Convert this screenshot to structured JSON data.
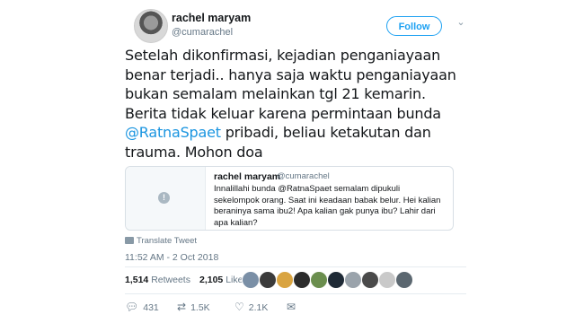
{
  "user": {
    "name": "rachel maryam",
    "handle": "@cumarachel"
  },
  "follow_label": "Follow",
  "tweet": {
    "text_before": "Setelah dikonfirmasi, kejadian penganiayaan benar terjadi.. hanya saja waktu penganiayaan bukan semalam melainkan tgl 21 kemarin. Berita tidak keluar karena permintaan bunda ",
    "mention": "@RatnaSpaet",
    "text_after": " pribadi, beliau ketakutan dan trauma. Mohon doa"
  },
  "quoted": {
    "name": "rachel maryam",
    "handle": "@cumarachel",
    "text": "Innalillahi bunda @RatnaSpaet semalam dipukuli sekelompok orang. Saat ini keadaan babak belur. Hei kalian beraninya sama ibu2! Apa kalian gak punya ibu? Lahir dari apa kalian?"
  },
  "translate_label": "Translate Tweet",
  "timestamp": "11:52 AM - 2 Oct 2018",
  "stats": {
    "retweets_count": "1,514",
    "retweets_label": "Retweets",
    "likes_count": "2,105",
    "likes_label": "Likes"
  },
  "likers_colors": [
    "#7a8fa6",
    "#3b3b3b",
    "#d9a441",
    "#2c2c2c",
    "#6b8e4e",
    "#1f2a36",
    "#9aa3ab",
    "#4a4a4a",
    "#c9c9c9",
    "#5b6770"
  ],
  "actions": {
    "reply_icon": "reply-icon",
    "reply_count": "431",
    "retweet_icon": "retweet-icon",
    "retweet_count": "1.5K",
    "like_icon": "heart-icon",
    "like_count": "2.1K",
    "dm_icon": "envelope-icon"
  },
  "colors": {
    "accent": "#1da1f2",
    "mention": "#1b95e0",
    "muted": "#657786"
  }
}
